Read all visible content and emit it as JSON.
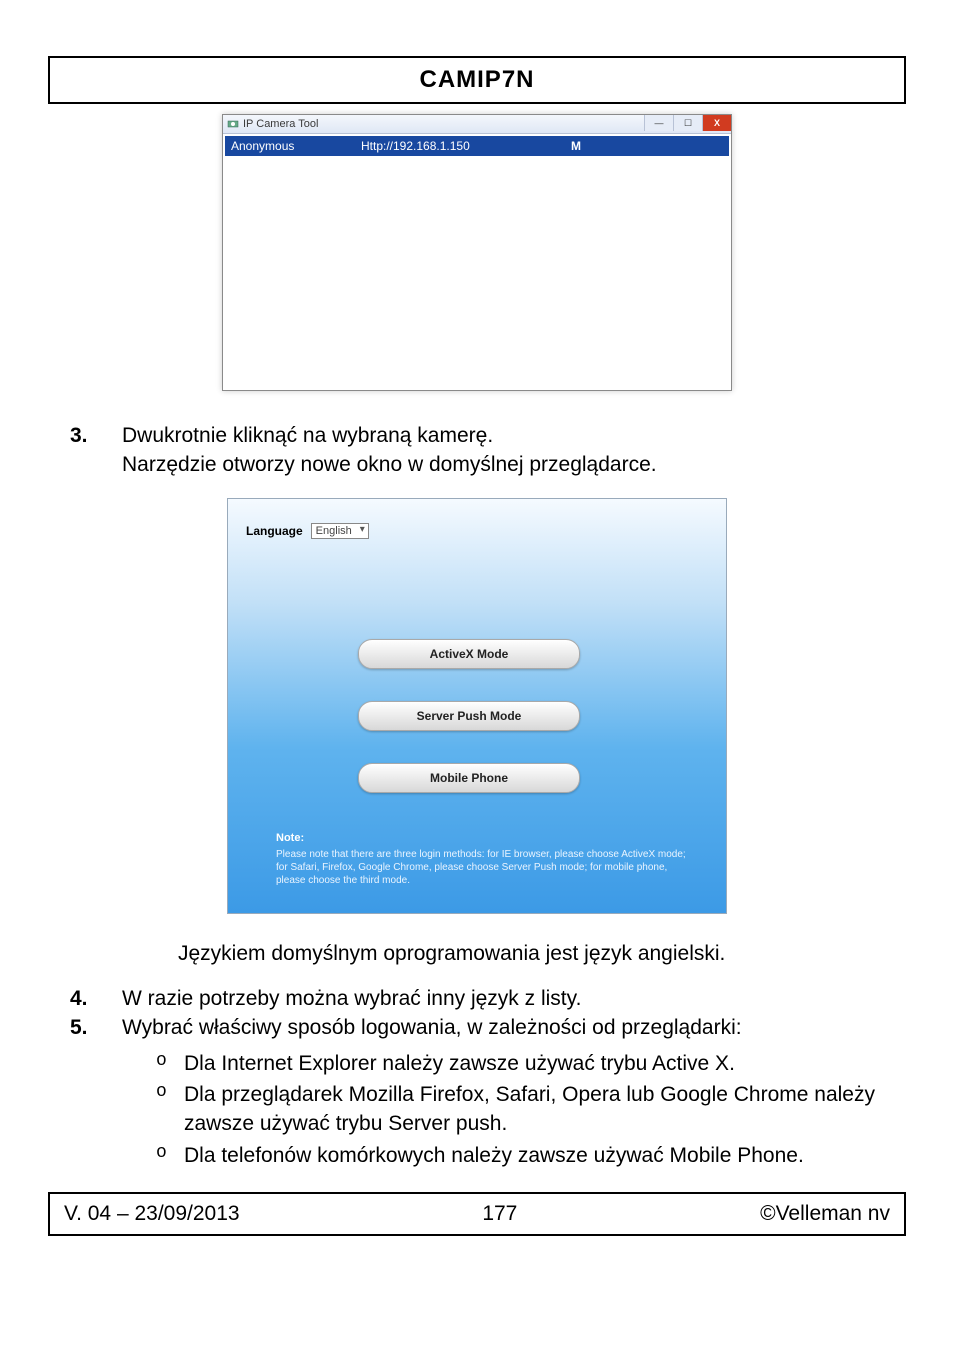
{
  "header": {
    "title": "CAMIP7N"
  },
  "figure1": {
    "window_title": "IP Camera Tool",
    "entry": {
      "name": "Anonymous",
      "url": "Http://192.168.1.150",
      "flag": "M"
    }
  },
  "step3": {
    "num": "3.",
    "line1": "Dwukrotnie kliknąć na wybraną kamerę.",
    "line2": "Narzędzie otworzy nowe okno w domyślnej przeglądarce."
  },
  "figure2": {
    "language_label": "Language",
    "language_value": "English",
    "btn_activex": "ActiveX Mode",
    "btn_serverpush": "Server Push Mode",
    "btn_mobile": "Mobile Phone",
    "note_title": "Note:",
    "note_body": "Please note that there are three login methods: for IE browser, please choose ActiveX mode; for Safari, Firefox, Google Chrome, please choose Server Push mode; for mobile phone, please choose the third mode."
  },
  "after_fig2": "Językiem domyślnym oprogramowania jest język angielski.",
  "step4": {
    "num": "4.",
    "text": "W razie potrzeby można wybrać inny język z listy."
  },
  "step5": {
    "num": "5.",
    "text": "Wybrać właściwy sposób logowania, w zależności od przeglądarki:",
    "bullets": [
      "Dla Internet Explorer należy zawsze używać trybu Active X.",
      "Dla przeglądarek Mozilla Firefox, Safari, Opera lub Google Chrome należy zawsze używać trybu Server push.",
      "Dla telefonów komórkowych należy zawsze używać Mobile Phone."
    ]
  },
  "footer": {
    "left": "V. 04 – 23/09/2013",
    "center": "177",
    "right": "©Velleman nv"
  }
}
